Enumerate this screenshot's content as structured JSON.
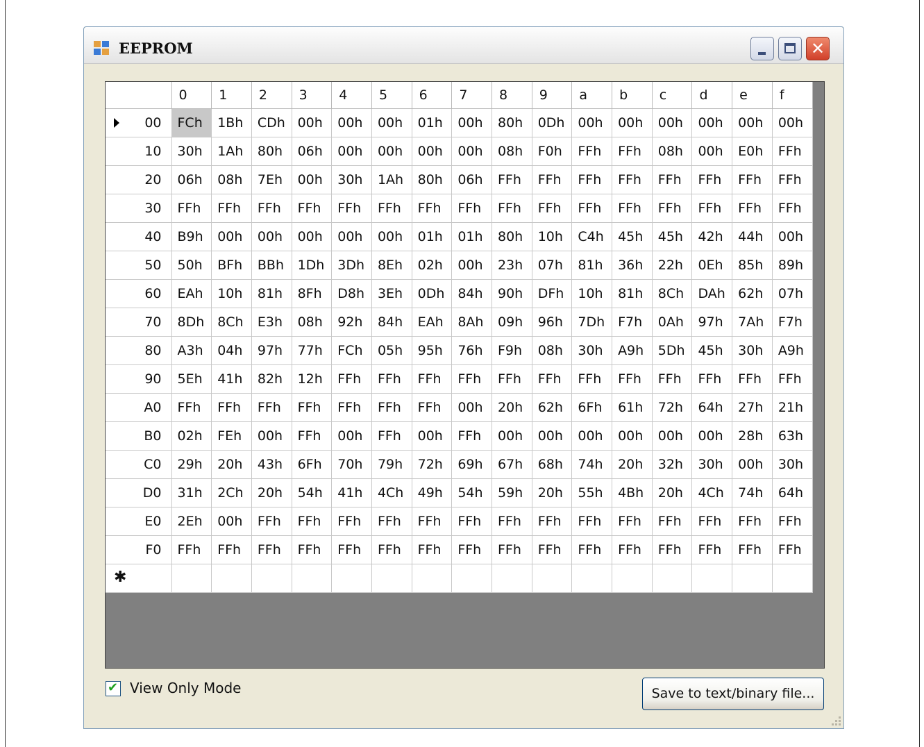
{
  "window": {
    "title": "EEPROM",
    "close_glyph": "✕"
  },
  "grid": {
    "columns": [
      "0",
      "1",
      "2",
      "3",
      "4",
      "5",
      "6",
      "7",
      "8",
      "9",
      "a",
      "b",
      "c",
      "d",
      "e",
      "f"
    ],
    "rows": [
      {
        "addr": "00",
        "values": [
          "FCh",
          "1Bh",
          "CDh",
          "00h",
          "00h",
          "00h",
          "01h",
          "00h",
          "80h",
          "0Dh",
          "00h",
          "00h",
          "00h",
          "00h",
          "00h",
          "00h"
        ]
      },
      {
        "addr": "10",
        "values": [
          "30h",
          "1Ah",
          "80h",
          "06h",
          "00h",
          "00h",
          "00h",
          "00h",
          "08h",
          "F0h",
          "FFh",
          "FFh",
          "08h",
          "00h",
          "E0h",
          "FFh"
        ]
      },
      {
        "addr": "20",
        "values": [
          "06h",
          "08h",
          "7Eh",
          "00h",
          "30h",
          "1Ah",
          "80h",
          "06h",
          "FFh",
          "FFh",
          "FFh",
          "FFh",
          "FFh",
          "FFh",
          "FFh",
          "FFh"
        ]
      },
      {
        "addr": "30",
        "values": [
          "FFh",
          "FFh",
          "FFh",
          "FFh",
          "FFh",
          "FFh",
          "FFh",
          "FFh",
          "FFh",
          "FFh",
          "FFh",
          "FFh",
          "FFh",
          "FFh",
          "FFh",
          "FFh"
        ]
      },
      {
        "addr": "40",
        "values": [
          "B9h",
          "00h",
          "00h",
          "00h",
          "00h",
          "00h",
          "01h",
          "01h",
          "80h",
          "10h",
          "C4h",
          "45h",
          "45h",
          "42h",
          "44h",
          "00h"
        ]
      },
      {
        "addr": "50",
        "values": [
          "50h",
          "BFh",
          "BBh",
          "1Dh",
          "3Dh",
          "8Eh",
          "02h",
          "00h",
          "23h",
          "07h",
          "81h",
          "36h",
          "22h",
          "0Eh",
          "85h",
          "89h"
        ]
      },
      {
        "addr": "60",
        "values": [
          "EAh",
          "10h",
          "81h",
          "8Fh",
          "D8h",
          "3Eh",
          "0Dh",
          "84h",
          "90h",
          "DFh",
          "10h",
          "81h",
          "8Ch",
          "DAh",
          "62h",
          "07h"
        ]
      },
      {
        "addr": "70",
        "values": [
          "8Dh",
          "8Ch",
          "E3h",
          "08h",
          "92h",
          "84h",
          "EAh",
          "8Ah",
          "09h",
          "96h",
          "7Dh",
          "F7h",
          "0Ah",
          "97h",
          "7Ah",
          "F7h"
        ]
      },
      {
        "addr": "80",
        "values": [
          "A3h",
          "04h",
          "97h",
          "77h",
          "FCh",
          "05h",
          "95h",
          "76h",
          "F9h",
          "08h",
          "30h",
          "A9h",
          "5Dh",
          "45h",
          "30h",
          "A9h"
        ]
      },
      {
        "addr": "90",
        "values": [
          "5Eh",
          "41h",
          "82h",
          "12h",
          "FFh",
          "FFh",
          "FFh",
          "FFh",
          "FFh",
          "FFh",
          "FFh",
          "FFh",
          "FFh",
          "FFh",
          "FFh",
          "FFh"
        ]
      },
      {
        "addr": "A0",
        "values": [
          "FFh",
          "FFh",
          "FFh",
          "FFh",
          "FFh",
          "FFh",
          "FFh",
          "00h",
          "20h",
          "62h",
          "6Fh",
          "61h",
          "72h",
          "64h",
          "27h",
          "21h"
        ]
      },
      {
        "addr": "B0",
        "values": [
          "02h",
          "FEh",
          "00h",
          "FFh",
          "00h",
          "FFh",
          "00h",
          "FFh",
          "00h",
          "00h",
          "00h",
          "00h",
          "00h",
          "00h",
          "28h",
          "63h"
        ]
      },
      {
        "addr": "C0",
        "values": [
          "29h",
          "20h",
          "43h",
          "6Fh",
          "70h",
          "79h",
          "72h",
          "69h",
          "67h",
          "68h",
          "74h",
          "20h",
          "32h",
          "30h",
          "00h",
          "30h"
        ]
      },
      {
        "addr": "D0",
        "values": [
          "31h",
          "2Ch",
          "20h",
          "54h",
          "41h",
          "4Ch",
          "49h",
          "54h",
          "59h",
          "20h",
          "55h",
          "4Bh",
          "20h",
          "4Ch",
          "74h",
          "64h"
        ]
      },
      {
        "addr": "E0",
        "values": [
          "2Eh",
          "00h",
          "FFh",
          "FFh",
          "FFh",
          "FFh",
          "FFh",
          "FFh",
          "FFh",
          "FFh",
          "FFh",
          "FFh",
          "FFh",
          "FFh",
          "FFh",
          "FFh"
        ]
      },
      {
        "addr": "F0",
        "values": [
          "FFh",
          "FFh",
          "FFh",
          "FFh",
          "FFh",
          "FFh",
          "FFh",
          "FFh",
          "FFh",
          "FFh",
          "FFh",
          "FFh",
          "FFh",
          "FFh",
          "FFh",
          "FFh"
        ]
      }
    ],
    "current_row_marker": "current-row-arrow-icon",
    "new_row_marker": "✱"
  },
  "footer": {
    "view_only_label": "View Only Mode",
    "view_only_checked": true,
    "check_glyph": "✔",
    "save_button_label": "Save to text/binary file..."
  },
  "colors": {
    "window_bg": "#ece9d8",
    "grid_empty_bg": "#808080",
    "selected_cell_bg": "#c8c8c8",
    "checkmark": "#21a121",
    "close_button": "#d1402a"
  }
}
